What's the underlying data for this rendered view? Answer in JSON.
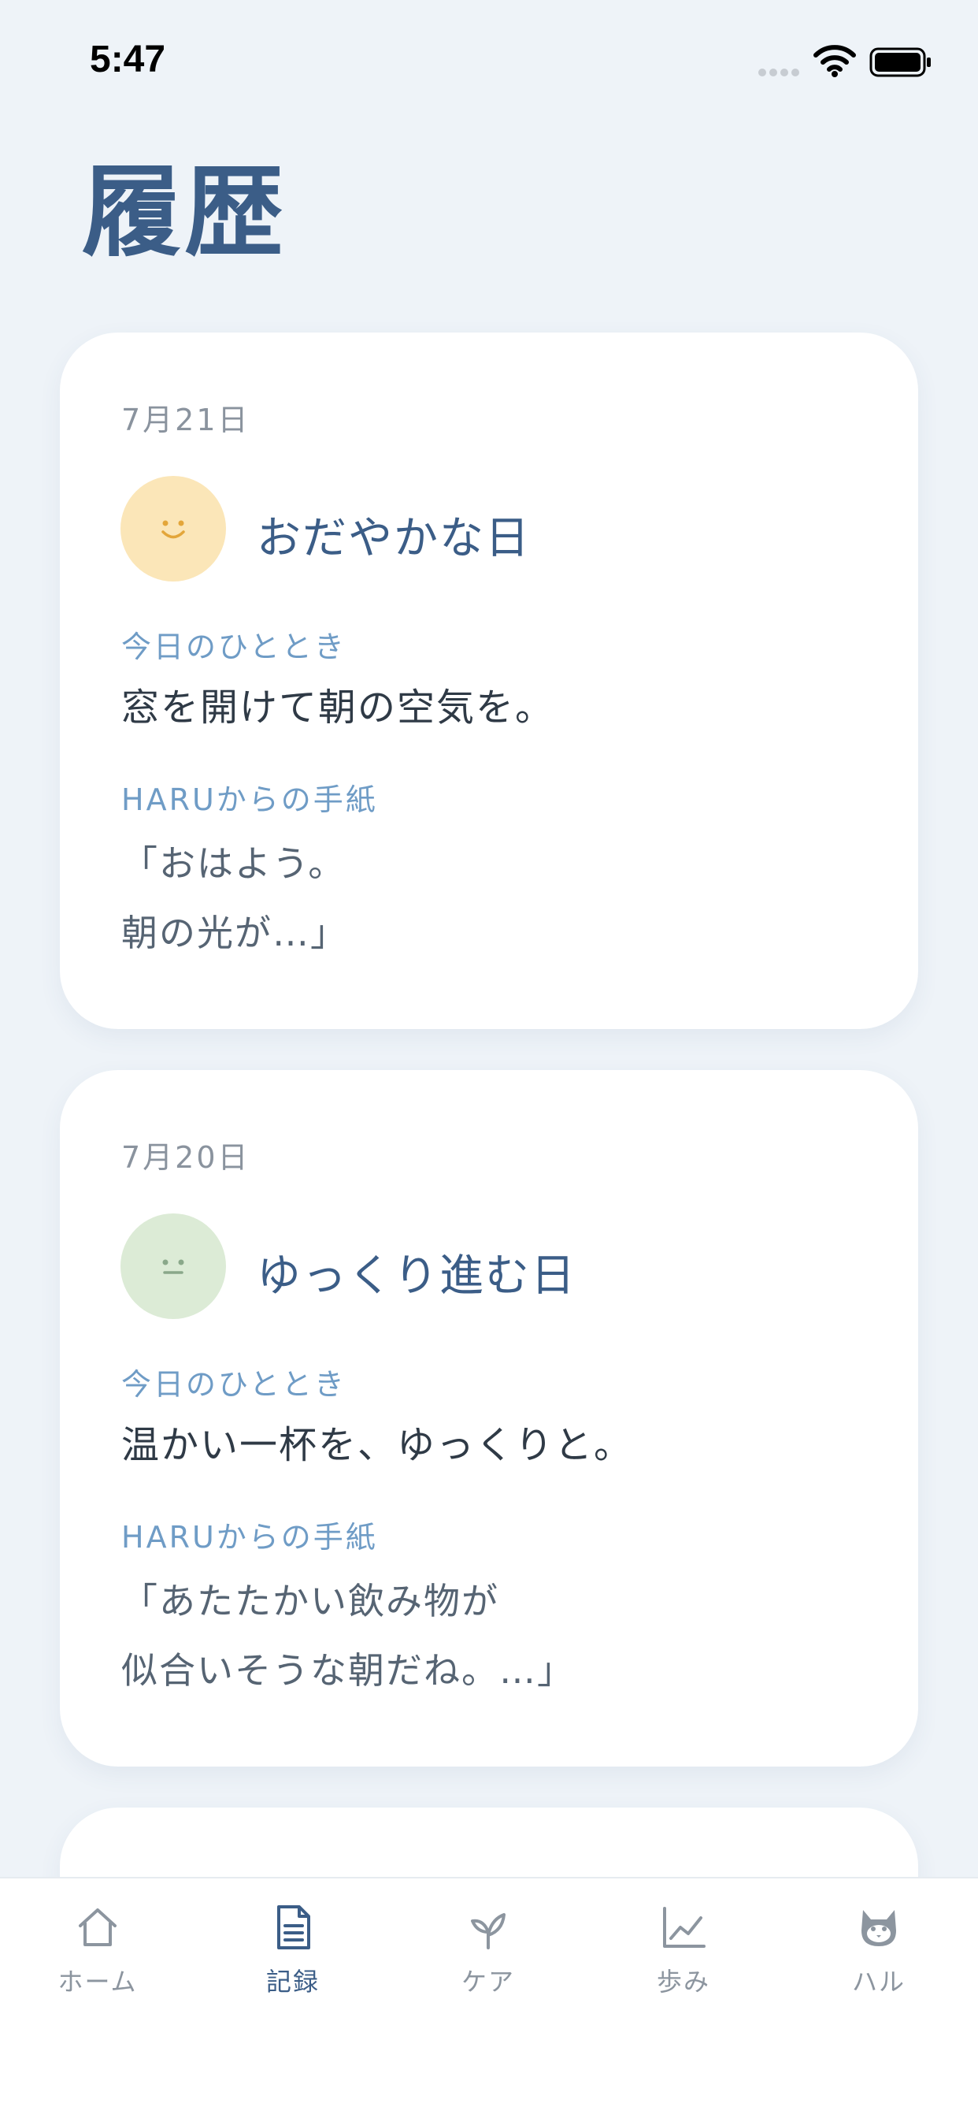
{
  "status_bar": {
    "time": "5:47"
  },
  "page": {
    "title": "履歴"
  },
  "entries": [
    {
      "date": "7月21日",
      "mood_title": "おだやかな日",
      "mood_icon": "smile-face-icon",
      "mood_color": "#fbe6b8",
      "moment_label": "今日のひととき",
      "moment_text": "窓を開けて朝の空気を。",
      "letter_label": "HARUからの手紙",
      "letter_lines": [
        "「おはよう。",
        "朝の光が…」"
      ]
    },
    {
      "date": "7月20日",
      "mood_title": "ゆっくり進む日",
      "mood_icon": "neutral-face-icon",
      "mood_color": "#dcebd6",
      "moment_label": "今日のひととき",
      "moment_text": "温かい一杯を、ゆっくりと。",
      "letter_label": "HARUからの手紙",
      "letter_lines": [
        "「あたたかい飲み物が",
        "似合いそうな朝だね。…」"
      ]
    }
  ],
  "tab_bar": {
    "active": "記録",
    "tabs": [
      {
        "label": "ホーム",
        "icon": "home-icon"
      },
      {
        "label": "記録",
        "icon": "document-icon"
      },
      {
        "label": "ケア",
        "icon": "sprout-icon"
      },
      {
        "label": "歩み",
        "icon": "chart-line-icon"
      },
      {
        "label": "ハル",
        "icon": "cat-face-icon"
      }
    ]
  },
  "colors": {
    "background": "#eef3f8",
    "title": "#3b5d87",
    "label_blue": "#6f9cc6",
    "tab_inactive": "#8c959f"
  }
}
